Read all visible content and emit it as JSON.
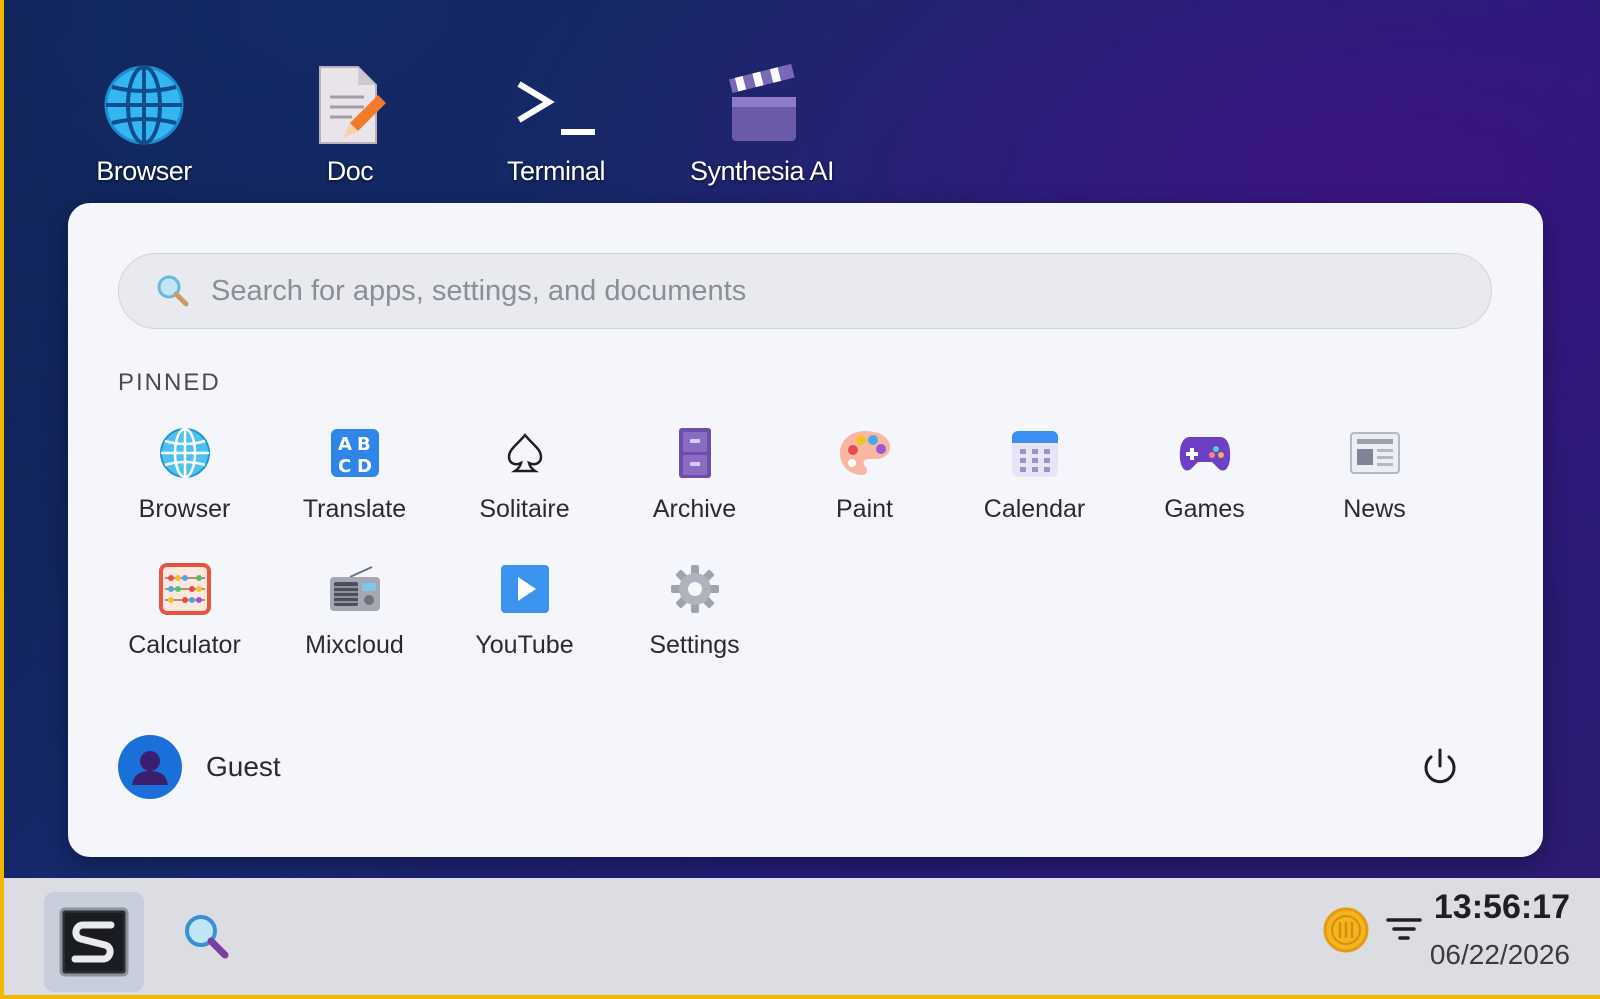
{
  "desktop": {
    "icons": [
      {
        "label": "Browser",
        "icon": "globe-icon"
      },
      {
        "label": "Doc",
        "icon": "document-icon"
      },
      {
        "label": "Terminal",
        "icon": "terminal-icon"
      },
      {
        "label": "Synthesia AI",
        "icon": "clapperboard-icon"
      }
    ]
  },
  "start_menu": {
    "search_placeholder": "Search for apps, settings, and documents",
    "pinned_title": "PINNED",
    "pinned_apps": [
      {
        "label": "Browser",
        "icon": "globe-icon"
      },
      {
        "label": "Translate",
        "icon": "abcd-icon"
      },
      {
        "label": "Solitaire",
        "icon": "spade-icon"
      },
      {
        "label": "Archive",
        "icon": "file-cabinet-icon"
      },
      {
        "label": "Paint",
        "icon": "palette-icon"
      },
      {
        "label": "Calendar",
        "icon": "calendar-icon"
      },
      {
        "label": "Games",
        "icon": "gamepad-icon"
      },
      {
        "label": "News",
        "icon": "newspaper-icon"
      },
      {
        "label": "Calculator",
        "icon": "abacus-icon"
      },
      {
        "label": "Mixcloud",
        "icon": "radio-icon"
      },
      {
        "label": "YouTube",
        "icon": "play-icon"
      },
      {
        "label": "Settings",
        "icon": "gear-icon"
      }
    ],
    "user_name": "Guest"
  },
  "taskbar": {
    "time": "13:56:17",
    "date": "06/22/2026"
  },
  "colors": {
    "accent_border": "#f2b705",
    "avatar_bg": "#1a6fd8",
    "menu_bg": "#f5f6fb"
  }
}
